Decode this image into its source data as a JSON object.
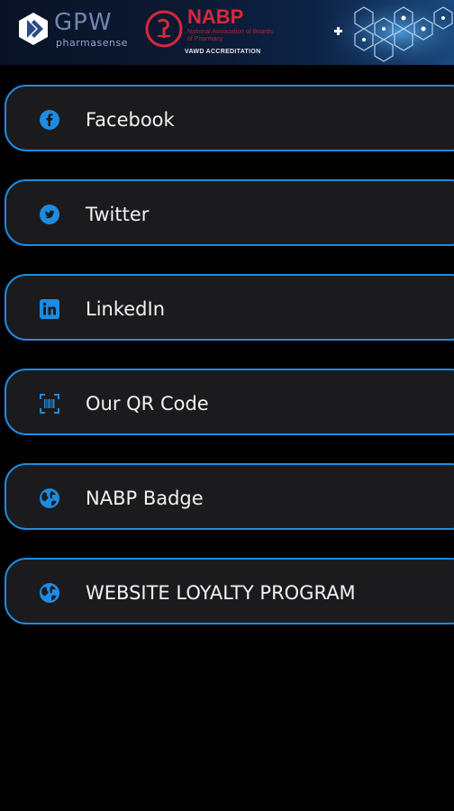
{
  "header": {
    "gpw_logo_text": "GPW",
    "gpw_subtext": "pharmasense",
    "nabp_title": "NABP",
    "nabp_subtitle": "National Association of Boards of Pharmacy",
    "accreditation": "VAWD ACCREDITATION"
  },
  "menu": {
    "items": [
      {
        "label": "Facebook",
        "icon": "facebook-icon"
      },
      {
        "label": "Twitter",
        "icon": "twitter-icon"
      },
      {
        "label": "LinkedIn",
        "icon": "linkedin-icon"
      },
      {
        "label": "Our QR Code",
        "icon": "qr-code-icon"
      },
      {
        "label": "NABP Badge",
        "icon": "globe-icon"
      },
      {
        "label": "WEBSITE LOYALTY PROGRAM",
        "icon": "globe-icon"
      }
    ]
  },
  "colors": {
    "accent": "#1e8be0",
    "card_bg": "#1b1b1d",
    "page_bg": "#000000",
    "label": "#f2f2f2",
    "nabp_red": "#d8283b"
  }
}
